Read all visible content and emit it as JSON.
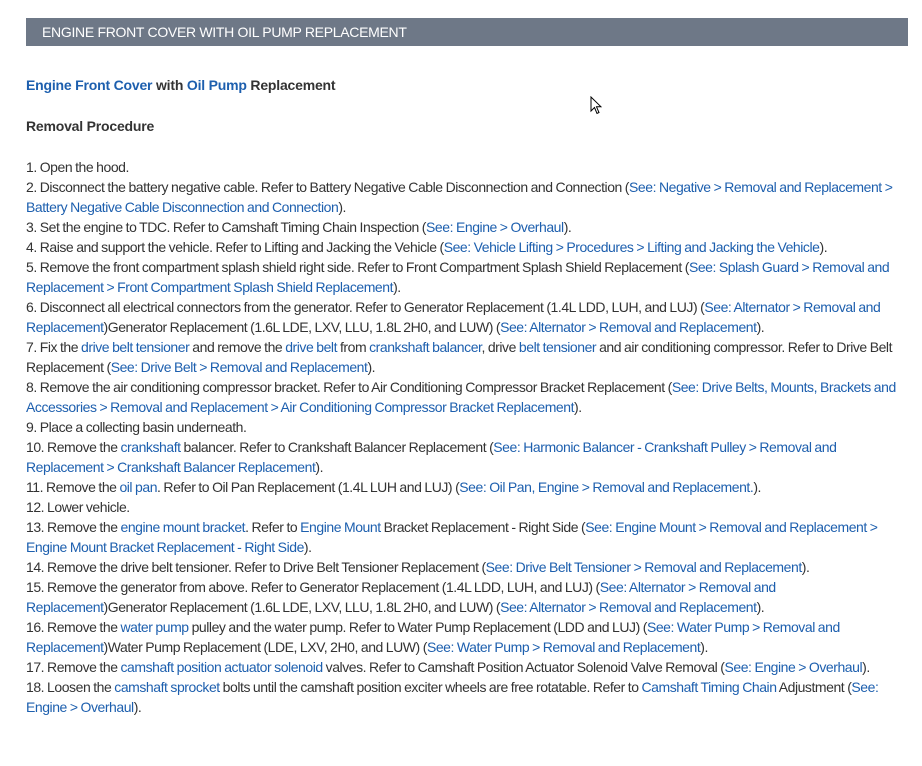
{
  "header": {
    "title": "ENGINE FRONT COVER WITH OIL PUMP REPLACEMENT"
  },
  "doc_title": {
    "part1": "Engine Front Cover",
    "part2": " with ",
    "part3": "Oil Pump",
    "part4": " Replacement"
  },
  "section": "Removal Procedure",
  "colors": {
    "header_bg": "#6e7887",
    "link": "#1d5fae",
    "text": "#333333"
  },
  "steps": [
    [
      {
        "t": " 1. Open the hood."
      }
    ],
    [
      {
        "t": " 2. Disconnect the battery negative cable. Refer to Battery Negative Cable Disconnection and Connection ("
      },
      {
        "t": "See: Negative > Removal and Replacement > Battery Negative Cable Disconnection and Connection",
        "link": true
      },
      {
        "t": ")."
      }
    ],
    [
      {
        "t": " 3. Set the engine to TDC. Refer to Camshaft Timing Chain Inspection ("
      },
      {
        "t": "See: Engine > Overhaul",
        "link": true
      },
      {
        "t": ")."
      }
    ],
    [
      {
        "t": " 4. Raise and support the vehicle. Refer to Lifting and Jacking the Vehicle ("
      },
      {
        "t": "See: Vehicle Lifting > Procedures > Lifting and Jacking the Vehicle",
        "link": true
      },
      {
        "t": ")."
      }
    ],
    [
      {
        "t": " 5. Remove the front compartment splash shield right side. Refer to Front Compartment Splash Shield Replacement ("
      },
      {
        "t": "See: Splash Guard > Removal and Replacement > Front Compartment Splash Shield Replacement",
        "link": true
      },
      {
        "t": ")."
      }
    ],
    [
      {
        "t": " 6. Disconnect all electrical connectors from the generator. Refer to Generator Replacement (1.4L LDD, LUH, and LUJ) ("
      },
      {
        "t": "See: Alternator > Removal and Replacement",
        "link": true
      },
      {
        "t": ")Generator Replacement (1.6L LDE, LXV, LLU, 1.8L 2H0, and LUW) ("
      },
      {
        "t": "See: Alternator > Removal and Replacement",
        "link": true
      },
      {
        "t": ")."
      }
    ],
    [
      {
        "t": " 7. Fix the "
      },
      {
        "t": "drive belt tensioner",
        "link": true
      },
      {
        "t": " and remove the "
      },
      {
        "t": "drive belt",
        "link": true
      },
      {
        "t": " from "
      },
      {
        "t": "crankshaft balancer",
        "link": true
      },
      {
        "t": ", drive "
      },
      {
        "t": "belt tensioner",
        "link": true
      },
      {
        "t": " and air conditioning compressor. Refer to Drive Belt Replacement ("
      },
      {
        "t": "See: Drive Belt > Removal and Replacement",
        "link": true
      },
      {
        "t": ")."
      }
    ],
    [
      {
        "t": " 8. Remove the air conditioning compressor bracket. Refer to Air Conditioning Compressor Bracket Replacement ("
      },
      {
        "t": "See: Drive Belts, Mounts, Brackets and Accessories > Removal and Replacement > Air Conditioning Compressor Bracket Replacement",
        "link": true
      },
      {
        "t": ")."
      }
    ],
    [
      {
        "t": " 9. Place a collecting basin underneath."
      }
    ],
    [
      {
        "t": "10. Remove the "
      },
      {
        "t": "crankshaft",
        "link": true
      },
      {
        "t": " balancer. Refer to Crankshaft Balancer Replacement ("
      },
      {
        "t": "See: Harmonic Balancer - Crankshaft Pulley > Removal and Replacement > Crankshaft Balancer Replacement",
        "link": true
      },
      {
        "t": ")."
      }
    ],
    [
      {
        "t": "11. Remove the "
      },
      {
        "t": "oil pan",
        "link": true
      },
      {
        "t": ". Refer to Oil Pan Replacement (1.4L LUH and LUJ) ("
      },
      {
        "t": "See: Oil Pan, Engine > Removal and Replacement.",
        "link": true
      },
      {
        "t": ")."
      }
    ],
    [
      {
        "t": "12. Lower vehicle."
      }
    ],
    [
      {
        "t": "13. Remove the "
      },
      {
        "t": "engine mount bracket",
        "link": true
      },
      {
        "t": ". Refer to "
      },
      {
        "t": "Engine Mount",
        "link": true
      },
      {
        "t": " Bracket Replacement - Right Side ("
      },
      {
        "t": "See: Engine Mount > Removal and Replacement > Engine Mount Bracket Replacement - Right Side",
        "link": true
      },
      {
        "t": ")."
      }
    ],
    [
      {
        "t": "14. Remove the drive belt tensioner. Refer to Drive Belt Tensioner Replacement ("
      },
      {
        "t": "See: Drive Belt Tensioner > Removal and Replacement",
        "link": true
      },
      {
        "t": ")."
      }
    ],
    [
      {
        "t": "15. Remove the generator from above. Refer to Generator Replacement (1.4L LDD, LUH, and LUJ) ("
      },
      {
        "t": "See: Alternator > Removal and Replacement",
        "link": true
      },
      {
        "t": ")Generator Replacement (1.6L LDE, LXV, LLU, 1.8L 2H0, and LUW) ("
      },
      {
        "t": "See: Alternator > Removal and Replacement",
        "link": true
      },
      {
        "t": ")."
      }
    ],
    [
      {
        "t": "16. Remove the "
      },
      {
        "t": "water pump",
        "link": true
      },
      {
        "t": " pulley and the water pump. Refer to Water Pump Replacement (LDD and LUJ) ("
      },
      {
        "t": "See: Water Pump > Removal and Replacement",
        "link": true
      },
      {
        "t": ")Water Pump Replacement (LDE, LXV, 2H0, and LUW) ("
      },
      {
        "t": "See: Water Pump > Removal and Replacement",
        "link": true
      },
      {
        "t": ")."
      }
    ],
    [
      {
        "t": "17. Remove the "
      },
      {
        "t": "camshaft position actuator solenoid",
        "link": true
      },
      {
        "t": " valves. Refer to Camshaft Position Actuator Solenoid Valve Removal ("
      },
      {
        "t": "See: Engine > Overhaul",
        "link": true
      },
      {
        "t": ")."
      }
    ],
    [
      {
        "t": "18. Loosen the "
      },
      {
        "t": "camshaft sprocket",
        "link": true
      },
      {
        "t": " bolts until the camshaft position exciter wheels are free rotatable. Refer to "
      },
      {
        "t": "Camshaft Timing Chain",
        "link": true
      },
      {
        "t": " Adjustment ("
      },
      {
        "t": "See: Engine > Overhaul",
        "link": true
      },
      {
        "t": ")."
      }
    ]
  ]
}
